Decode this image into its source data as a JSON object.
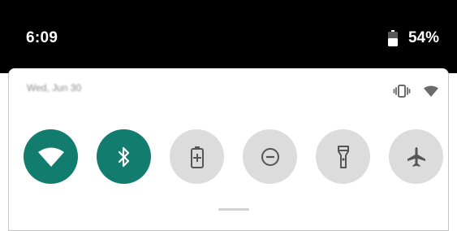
{
  "status_bar": {
    "time": "6:09",
    "battery_percent": "54%",
    "battery_level": 0.54,
    "background": "#000000"
  },
  "quick_settings": {
    "date": "Wed, Jun 30",
    "accent": "#127d6e",
    "status_icons": [
      "vibrate-icon",
      "wifi-signal-icon"
    ],
    "tiles": [
      {
        "id": "wifi",
        "icon": "wifi-icon",
        "active": true
      },
      {
        "id": "bluetooth",
        "icon": "bluetooth-icon",
        "active": true
      },
      {
        "id": "battery-saver",
        "icon": "battery-saver-icon",
        "active": false
      },
      {
        "id": "do-not-disturb",
        "icon": "do-not-disturb-icon",
        "active": false
      },
      {
        "id": "flashlight",
        "icon": "flashlight-icon",
        "active": false
      },
      {
        "id": "airplane-mode",
        "icon": "airplane-icon",
        "active": false
      }
    ]
  }
}
